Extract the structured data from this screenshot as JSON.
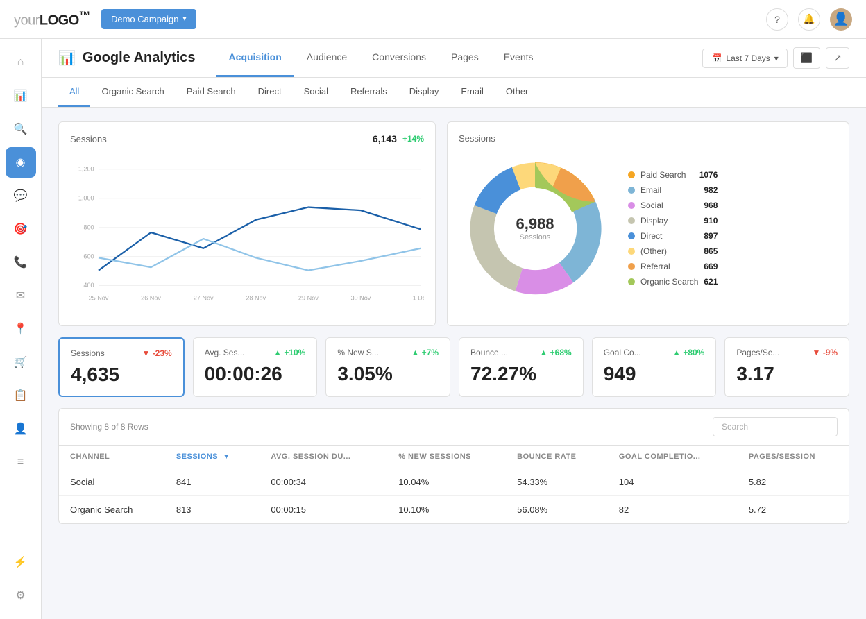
{
  "app": {
    "logo": "your",
    "logo_brand": "LOGO",
    "logo_tm": "™",
    "demo_btn": "Demo Campaign"
  },
  "top_nav": {
    "help_icon": "?",
    "bell_icon": "🔔",
    "avatar_icon": "👤"
  },
  "sidebar": {
    "items": [
      {
        "id": "home",
        "icon": "⌂",
        "active": false
      },
      {
        "id": "analytics",
        "icon": "📊",
        "active": false
      },
      {
        "id": "search",
        "icon": "🔍",
        "active": false
      },
      {
        "id": "dashboard",
        "icon": "◉",
        "active": true
      },
      {
        "id": "chat",
        "icon": "💬",
        "active": false
      },
      {
        "id": "targeting",
        "icon": "🎯",
        "active": false
      },
      {
        "id": "phone",
        "icon": "📞",
        "active": false
      },
      {
        "id": "email",
        "icon": "✉",
        "active": false
      },
      {
        "id": "location",
        "icon": "📍",
        "active": false
      },
      {
        "id": "cart",
        "icon": "🛒",
        "active": false
      },
      {
        "id": "reports",
        "icon": "📋",
        "active": false
      },
      {
        "id": "users",
        "icon": "👤",
        "active": false
      },
      {
        "id": "lists",
        "icon": "≡",
        "active": false
      },
      {
        "id": "plugins",
        "icon": "⚡",
        "active": false
      },
      {
        "id": "settings",
        "icon": "⚙",
        "active": false
      }
    ]
  },
  "page": {
    "icon": "📊",
    "title": "Google Analytics",
    "tabs": [
      {
        "id": "acquisition",
        "label": "Acquisition",
        "active": true
      },
      {
        "id": "audience",
        "label": "Audience",
        "active": false
      },
      {
        "id": "conversions",
        "label": "Conversions",
        "active": false
      },
      {
        "id": "pages",
        "label": "Pages",
        "active": false
      },
      {
        "id": "events",
        "label": "Events",
        "active": false
      }
    ],
    "date_range": "Last 7 Days",
    "date_icon": "📅"
  },
  "sub_tabs": [
    {
      "id": "all",
      "label": "All",
      "active": true
    },
    {
      "id": "organic",
      "label": "Organic Search",
      "active": false
    },
    {
      "id": "paid",
      "label": "Paid Search",
      "active": false
    },
    {
      "id": "direct",
      "label": "Direct",
      "active": false
    },
    {
      "id": "social",
      "label": "Social",
      "active": false
    },
    {
      "id": "referrals",
      "label": "Referrals",
      "active": false
    },
    {
      "id": "display",
      "label": "Display",
      "active": false
    },
    {
      "id": "email",
      "label": "Email",
      "active": false
    },
    {
      "id": "other",
      "label": "Other",
      "active": false
    }
  ],
  "sessions_chart": {
    "title": "Sessions",
    "value": "6,143",
    "trend": "+14%",
    "trend_direction": "up",
    "y_labels": [
      "1,200",
      "1,000",
      "800",
      "600",
      "400"
    ],
    "x_labels": [
      "25 Nov",
      "26 Nov",
      "27 Nov",
      "28 Nov",
      "29 Nov",
      "30 Nov",
      "1 Dec"
    ]
  },
  "donut_chart": {
    "title": "Sessions",
    "center_value": "6,988",
    "center_label": "Sessions",
    "segments": [
      {
        "label": "Paid Search",
        "value": 1076,
        "color": "#f5a623",
        "pct": 15.4
      },
      {
        "label": "Email",
        "value": 982,
        "color": "#7eb5d6",
        "pct": 14.1
      },
      {
        "label": "Social",
        "value": 968,
        "color": "#d98ee6",
        "pct": 13.9
      },
      {
        "label": "Display",
        "value": 910,
        "color": "#b5b5a0",
        "pct": 13.0
      },
      {
        "label": "Direct",
        "value": 897,
        "color": "#4a90d9",
        "pct": 12.8
      },
      {
        "label": "(Other)",
        "value": 865,
        "color": "#fdd87a",
        "pct": 12.4
      },
      {
        "label": "Referral",
        "value": 669,
        "color": "#f0a04b",
        "pct": 9.6
      },
      {
        "label": "Organic Search",
        "value": 621,
        "color": "#a3c85a",
        "pct": 8.9
      }
    ]
  },
  "metrics": [
    {
      "id": "sessions",
      "label": "Sessions",
      "value": "4,635",
      "trend": "-23%",
      "direction": "down",
      "selected": true
    },
    {
      "id": "avg-session",
      "label": "Avg. Ses...",
      "value": "00:00:26",
      "trend": "+10%",
      "direction": "up",
      "selected": false
    },
    {
      "id": "new-sessions",
      "label": "% New S...",
      "value": "3.05%",
      "trend": "+7%",
      "direction": "up",
      "selected": false
    },
    {
      "id": "bounce",
      "label": "Bounce ...",
      "value": "72.27%",
      "trend": "+68%",
      "direction": "up",
      "selected": false
    },
    {
      "id": "goal",
      "label": "Goal Co...",
      "value": "949",
      "trend": "+80%",
      "direction": "up",
      "selected": false
    },
    {
      "id": "pages",
      "label": "Pages/Se...",
      "value": "3.17",
      "trend": "-9%",
      "direction": "down",
      "selected": false
    }
  ],
  "table": {
    "showing_text": "Showing 8 of 8 Rows",
    "search_placeholder": "Search",
    "columns": [
      {
        "id": "channel",
        "label": "CHANNEL",
        "sort": false
      },
      {
        "id": "sessions",
        "label": "SESSIONS",
        "sort": true
      },
      {
        "id": "avg_session",
        "label": "AVG. SESSION DU...",
        "sort": false
      },
      {
        "id": "new_sessions",
        "label": "% NEW SESSIONS",
        "sort": false
      },
      {
        "id": "bounce",
        "label": "BOUNCE RATE",
        "sort": false
      },
      {
        "id": "goal",
        "label": "GOAL COMPLETIO...",
        "sort": false
      },
      {
        "id": "pages",
        "label": "PAGES/SESSION",
        "sort": false
      }
    ],
    "rows": [
      {
        "channel": "Social",
        "sessions": "841",
        "avg_session": "00:00:34",
        "new_sessions": "10.04%",
        "bounce": "54.33%",
        "goal": "104",
        "pages": "5.82"
      },
      {
        "channel": "Organic Search",
        "sessions": "813",
        "avg_session": "00:00:15",
        "new_sessions": "10.10%",
        "bounce": "56.08%",
        "goal": "82",
        "pages": "5.72"
      }
    ]
  }
}
